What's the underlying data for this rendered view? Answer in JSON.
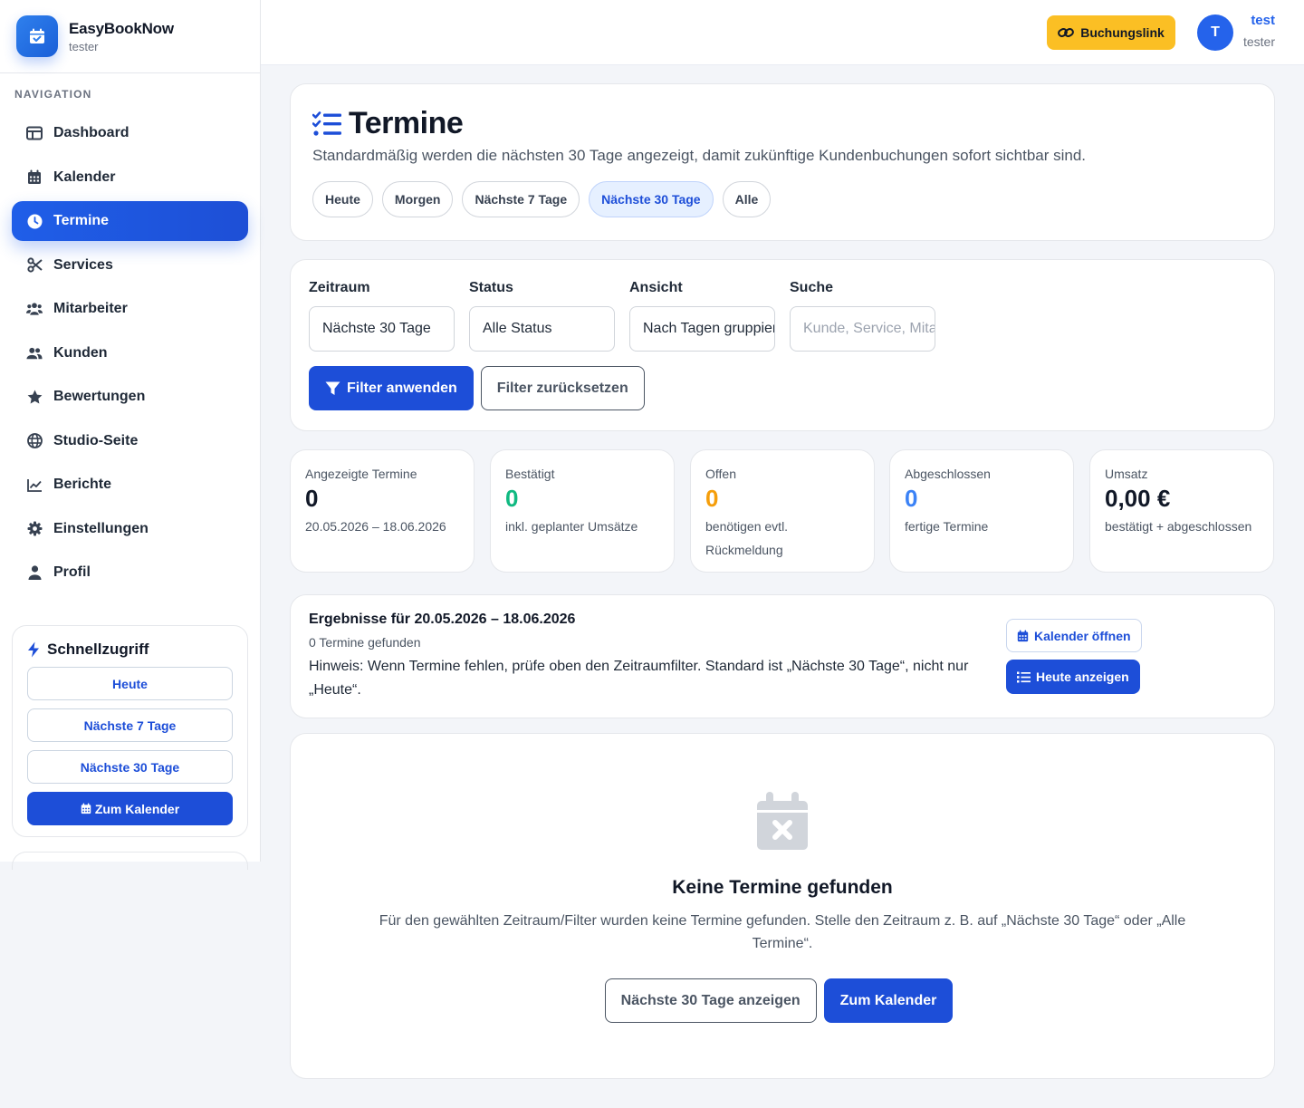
{
  "brand": {
    "name": "EasyBookNow",
    "sub": "tester"
  },
  "nav": {
    "title": "NAVIGATION",
    "items": [
      {
        "label": "Dashboard",
        "icon": "dashboard-icon"
      },
      {
        "label": "Kalender",
        "icon": "calendar-icon"
      },
      {
        "label": "Termine",
        "icon": "clock-icon",
        "active": true
      },
      {
        "label": "Services",
        "icon": "scissors-icon"
      },
      {
        "label": "Mitarbeiter",
        "icon": "team-icon"
      },
      {
        "label": "Kunden",
        "icon": "users-icon"
      },
      {
        "label": "Bewertungen",
        "icon": "star-icon"
      },
      {
        "label": "Studio-Seite",
        "icon": "globe-icon"
      },
      {
        "label": "Berichte",
        "icon": "chart-line-icon"
      },
      {
        "label": "Einstellungen",
        "icon": "gear-icon"
      },
      {
        "label": "Profil",
        "icon": "user-icon"
      }
    ]
  },
  "quick": {
    "title": "Schnellzugriff",
    "today": "Heute",
    "next7": "Nächste 7 Tage",
    "next30": "Nächste 30 Tage",
    "calendar": "Zum Kalender"
  },
  "topbar": {
    "booking_link": "Buchungslink",
    "avatar_letter": "T",
    "user_name": "test",
    "user_sub": "tester"
  },
  "header": {
    "title": "Termine",
    "subtitle": "Standardmäßig werden die nächsten 30 Tage angezeigt, damit zukünftige Kundenbuchungen sofort sichtbar sind.",
    "pills": [
      "Heute",
      "Morgen",
      "Nächste 7 Tage",
      "Nächste 30 Tage",
      "Alle"
    ],
    "active_pill": "Nächste 30 Tage"
  },
  "filters": {
    "period_label": "Zeitraum",
    "period_value": "Nächste 30 Tage",
    "status_label": "Status",
    "status_value": "Alle Status",
    "view_label": "Ansicht",
    "view_value": "Nach Tagen gruppiert",
    "search_label": "Suche",
    "search_placeholder": "Kunde, Service, Mitarbeiter",
    "apply": "Filter anwenden",
    "reset": "Filter zurücksetzen"
  },
  "stats": [
    {
      "label": "Angezeigte Termine",
      "value": "0",
      "desc": "20.05.2026 – 18.06.2026",
      "color": "#111827"
    },
    {
      "label": "Bestätigt",
      "value": "0",
      "desc": "inkl. geplanter Umsätze",
      "color": "#10b981"
    },
    {
      "label": "Offen",
      "value": "0",
      "desc": "benötigen evtl. Rückmeldung",
      "color": "#f59e0b"
    },
    {
      "label": "Abgeschlossen",
      "value": "0",
      "desc": "fertige Termine",
      "color": "#3b82f6"
    },
    {
      "label": "Umsatz",
      "value": "0,00 €",
      "desc": "bestätigt + abgeschlossen",
      "color": "#111827"
    }
  ],
  "results": {
    "title": "Ergebnisse für 20.05.2026 – 18.06.2026",
    "count": "0 Termine gefunden",
    "hint": "Hinweis: Wenn Termine fehlen, prüfe oben den Zeitraumfilter. Standard ist „Nächste 30 Tage“, nicht nur „Heute“.",
    "open_calendar": "Kalender öffnen",
    "show_today": "Heute anzeigen"
  },
  "empty": {
    "title": "Keine Termine gefunden",
    "desc": "Für den gewählten Zeitraum/Filter wurden keine Termine gefunden. Stelle den Zeitraum z. B. auf „Nächste 30 Tage“ oder „Alle Termine“.",
    "btn_next30": "Nächste 30 Tage anzeigen",
    "btn_calendar": "Zum Kalender"
  },
  "colors": {
    "accent": "#1d4ed8",
    "booking": "#fbbf24"
  }
}
